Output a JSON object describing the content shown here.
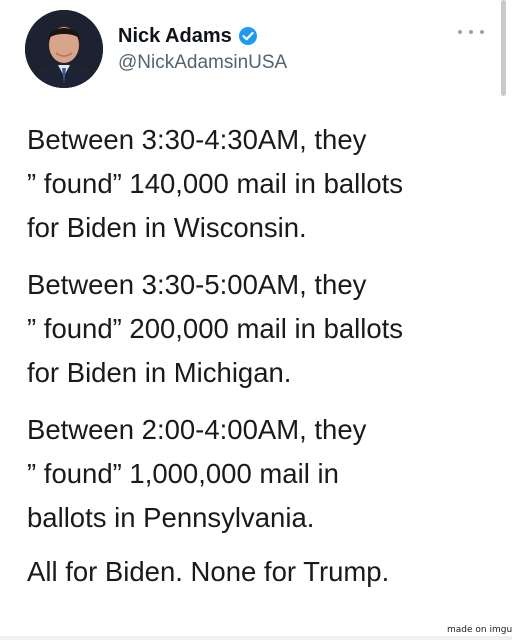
{
  "author": {
    "name": "Nick Adams",
    "handle": "@NickAdamsinUSA",
    "verified_icon": "verified-badge-icon",
    "avatar": "profile-photo"
  },
  "more_icon": "more-options-icon",
  "tweet": {
    "paragraphs": [
      {
        "lines": [
          "Between 3:30-4:30AM, they",
          "” found” 140,000 mail in ballots",
          "for Biden in Wisconsin."
        ]
      },
      {
        "lines": [
          "Between 3:30-5:00AM, they",
          "” found” 200,000 mail in ballots",
          "for Biden in Michigan."
        ]
      },
      {
        "lines": [
          "Between 2:00-4:00AM, they",
          "” found” 1,000,000 mail in",
          "ballots in Pennsylvania."
        ]
      }
    ],
    "closing": "All for Biden. None for Trump."
  },
  "watermark": "made on imgur",
  "colors": {
    "verified": "#1d9bf0",
    "handle": "#536471",
    "text": "#1a1a1a"
  }
}
